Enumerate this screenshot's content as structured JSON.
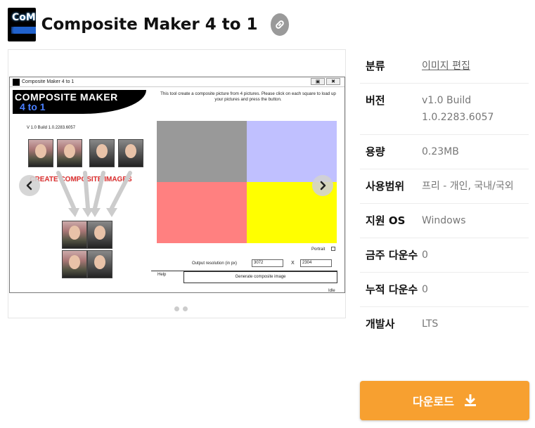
{
  "app": {
    "icon_text": "CoM",
    "title": "Composite Maker 4 to 1"
  },
  "screenshot": {
    "window_title": "Composite Maker 4 to 1",
    "banner_line1": "COMPOSITE MAKER",
    "banner_line2": "4 to 1",
    "version": "V 1.0 Build 1.0.2283.6057",
    "description": "This tool create a composite picture from 4 pictures. Please click on each square to load up your pictures and press the button.",
    "create_text": "CREATE COMPOSITE IMAGES",
    "grid_colors": [
      "#999999",
      "#c0c0ff",
      "#ff8080",
      "#ffff00"
    ],
    "portrait_label": "Portrait",
    "resolution_label": "Output resolution (in px)",
    "width_value": "3072",
    "height_value": "2304",
    "x_sep": "X",
    "help_label": "Help",
    "generate_label": "Generate composite image",
    "status": "Idle"
  },
  "gallery": {
    "prev_icon": "chevron-left-icon",
    "next_icon": "chevron-right-icon",
    "dots": 2
  },
  "info": {
    "rows": [
      {
        "label": "분류",
        "value": "이미지 편집",
        "link": true
      },
      {
        "label": "버전",
        "value": "v1.0 Build 1.0.2283.6057"
      },
      {
        "label": "용량",
        "value": "0.23MB"
      },
      {
        "label": "사용범위",
        "value": "프리 - 개인, 국내/국외"
      },
      {
        "label": "지원 OS",
        "value": "Windows"
      },
      {
        "label": "금주 다운수",
        "value": "0"
      },
      {
        "label": "누적 다운수",
        "value": "0"
      },
      {
        "label": "개발사",
        "value": "LTS"
      }
    ]
  },
  "download": {
    "label": "다운로드",
    "color": "#f7a030"
  }
}
